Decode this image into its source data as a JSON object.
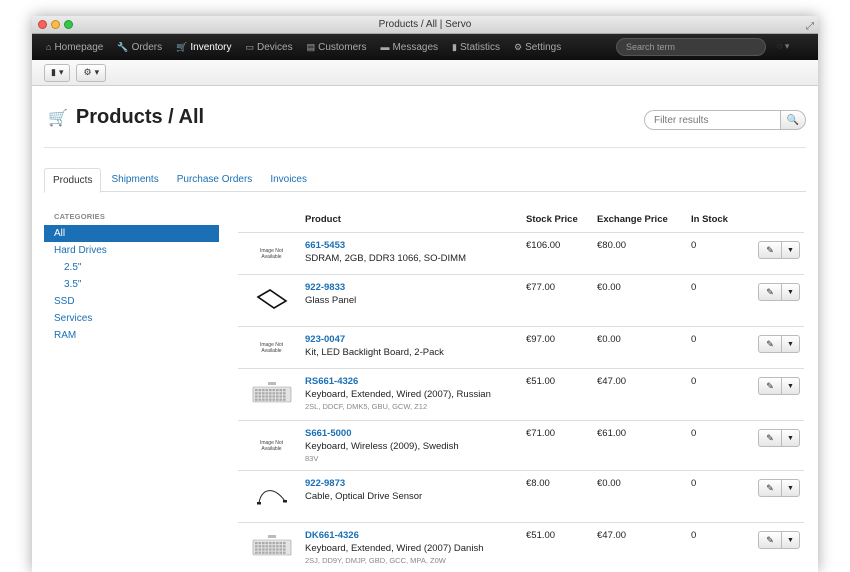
{
  "window": {
    "title": "Products / All | Servo"
  },
  "nav": {
    "items": [
      {
        "label": "Homepage",
        "icon": "home-icon",
        "glyph": "⌂",
        "active": false
      },
      {
        "label": "Orders",
        "icon": "wrench-icon",
        "glyph": "🔧",
        "active": false
      },
      {
        "label": "Inventory",
        "icon": "cart-icon",
        "glyph": "🛒",
        "active": true
      },
      {
        "label": "Devices",
        "icon": "laptop-icon",
        "glyph": "▭",
        "active": false
      },
      {
        "label": "Customers",
        "icon": "book-icon",
        "glyph": "▤",
        "active": false
      },
      {
        "label": "Messages",
        "icon": "comment-icon",
        "glyph": "▬",
        "active": false
      },
      {
        "label": "Statistics",
        "icon": "signal-icon",
        "glyph": "▮",
        "active": false
      },
      {
        "label": "Settings",
        "icon": "gear-icon",
        "glyph": "⚙",
        "active": false
      }
    ],
    "search_placeholder": "Search term"
  },
  "page": {
    "title": "Products / All",
    "filter_placeholder": "Filter results"
  },
  "tabs": [
    {
      "label": "Products",
      "active": true
    },
    {
      "label": "Shipments",
      "active": false
    },
    {
      "label": "Purchase Orders",
      "active": false
    },
    {
      "label": "Invoices",
      "active": false
    }
  ],
  "sidebar": {
    "header": "CATEGORIES",
    "items": [
      {
        "label": "All",
        "active": true,
        "sub": false
      },
      {
        "label": "Hard Drives",
        "active": false,
        "sub": false
      },
      {
        "label": "2.5\"",
        "active": false,
        "sub": true
      },
      {
        "label": "3.5\"",
        "active": false,
        "sub": true
      },
      {
        "label": "SSD",
        "active": false,
        "sub": false
      },
      {
        "label": "Services",
        "active": false,
        "sub": false
      },
      {
        "label": "RAM",
        "active": false,
        "sub": false
      }
    ]
  },
  "table": {
    "columns": [
      "Product",
      "Stock Price",
      "Exchange Price",
      "In Stock"
    ],
    "no_image_text": "Image Not Available",
    "rows": [
      {
        "sku": "661-5453",
        "desc": "SDRAM, 2GB, DDR3 1066, SO-DIMM",
        "meta": "",
        "stock_price": "€106.00",
        "exchange_price": "€80.00",
        "in_stock": "0",
        "image": "none"
      },
      {
        "sku": "922-9833",
        "desc": "Glass Panel",
        "meta": "",
        "stock_price": "€77.00",
        "exchange_price": "€0.00",
        "in_stock": "0",
        "image": "glass-panel"
      },
      {
        "sku": "923-0047",
        "desc": "Kit, LED Backlight Board, 2-Pack",
        "meta": "",
        "stock_price": "€97.00",
        "exchange_price": "€0.00",
        "in_stock": "0",
        "image": "none"
      },
      {
        "sku": "RS661-4326",
        "desc": "Keyboard, Extended, Wired (2007), Russian",
        "meta": "2SL, DDCF, DMK5, GBU, GCW, Z12",
        "stock_price": "€51.00",
        "exchange_price": "€47.00",
        "in_stock": "0",
        "image": "keyboard"
      },
      {
        "sku": "S661-5000",
        "desc": "Keyboard, Wireless (2009), Swedish",
        "meta": "83V",
        "stock_price": "€71.00",
        "exchange_price": "€61.00",
        "in_stock": "0",
        "image": "none"
      },
      {
        "sku": "922-9873",
        "desc": "Cable, Optical Drive Sensor",
        "meta": "",
        "stock_price": "€8.00",
        "exchange_price": "€0.00",
        "in_stock": "0",
        "image": "cable"
      },
      {
        "sku": "DK661-4326",
        "desc": "Keyboard, Extended, Wired (2007) Danish",
        "meta": "2SJ, DD9Y, DMJP, GBD, GCC, MPA, Z0W",
        "stock_price": "€51.00",
        "exchange_price": "€47.00",
        "in_stock": "0",
        "image": "keyboard"
      }
    ]
  }
}
